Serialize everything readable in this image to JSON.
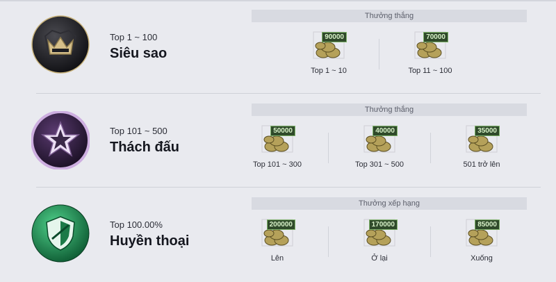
{
  "tiers": [
    {
      "range": "Top 1 ~ 100",
      "name": "Siêu sao",
      "reward_title": "Thưởng thắng",
      "badge_icon": "crown-icon",
      "badge_color": "#1e1e22",
      "rewards": [
        {
          "amount": "90000",
          "label": "Top 1 ~ 10"
        },
        {
          "amount": "70000",
          "label": "Top 11 ~ 100"
        }
      ]
    },
    {
      "range": "Top 101 ~ 500",
      "name": "Thách đấu",
      "reward_title": "Thưởng thắng",
      "badge_icon": "star-icon",
      "badge_color": "#4a1f5e",
      "rewards": [
        {
          "amount": "50000",
          "label": "Top 101 ~ 300"
        },
        {
          "amount": "40000",
          "label": "Top 301 ~ 500"
        },
        {
          "amount": "35000",
          "label": "501 trở lên"
        }
      ]
    },
    {
      "range": "Top 100.00%",
      "name": "Huyền thoại",
      "reward_title": "Thưởng xếp hạng",
      "badge_icon": "shield-icon",
      "badge_color": "#1f8a55",
      "rewards": [
        {
          "amount": "200000",
          "label": "Lên"
        },
        {
          "amount": "170000",
          "label": "Ở lại"
        },
        {
          "amount": "85000",
          "label": "Xuống"
        }
      ]
    }
  ]
}
